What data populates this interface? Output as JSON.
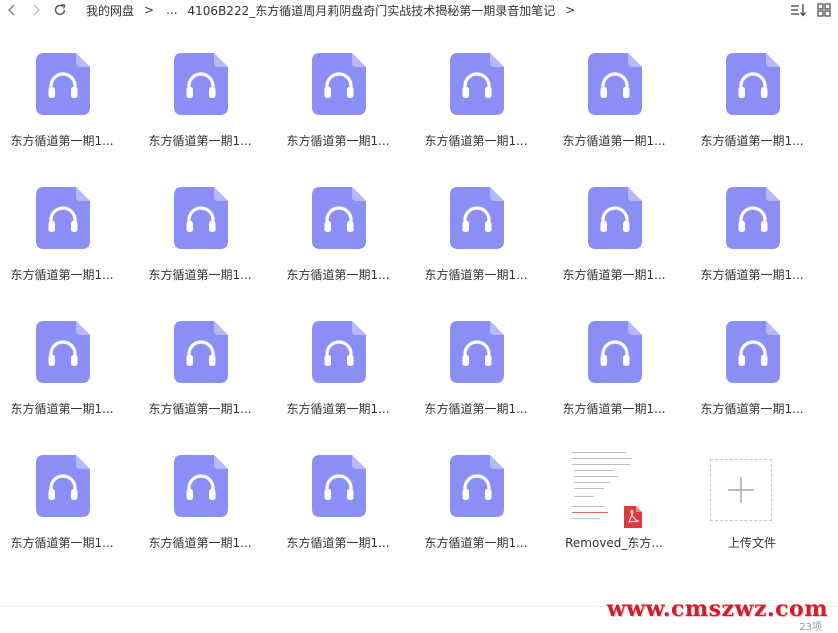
{
  "toolbar": {
    "back_icon": "chevron-left-icon",
    "forward_icon": "chevron-right-icon",
    "refresh_icon": "refresh-icon",
    "crumb_root": "我的网盘",
    "crumb_sep": ">",
    "crumb_ellipsis": "...",
    "crumb_current": "4106B222_东方循道周月莉阴盘奇门实战技术揭秘第一期录音加笔记",
    "crumb_trail_sep": ">",
    "sort_icon": "sort-icon",
    "view_icon": "view-toggle-icon"
  },
  "files": [
    {
      "name": "东方循道第一期1...",
      "type": "audio"
    },
    {
      "name": "东方循道第一期1...",
      "type": "audio"
    },
    {
      "name": "东方循道第一期1...",
      "type": "audio"
    },
    {
      "name": "东方循道第一期1...",
      "type": "audio"
    },
    {
      "name": "东方循道第一期1...",
      "type": "audio"
    },
    {
      "name": "东方循道第一期1...",
      "type": "audio"
    },
    {
      "name": "东方循道第一期1...",
      "type": "audio"
    },
    {
      "name": "东方循道第一期1...",
      "type": "audio"
    },
    {
      "name": "东方循道第一期1...",
      "type": "audio"
    },
    {
      "name": "东方循道第一期1...",
      "type": "audio"
    },
    {
      "name": "东方循道第一期1...",
      "type": "audio"
    },
    {
      "name": "东方循道第一期1...",
      "type": "audio"
    },
    {
      "name": "东方循道第一期1...",
      "type": "audio"
    },
    {
      "name": "东方循道第一期1...",
      "type": "audio"
    },
    {
      "name": "东方循道第一期1...",
      "type": "audio"
    },
    {
      "name": "东方循道第一期1...",
      "type": "audio"
    },
    {
      "name": "东方循道第一期1...",
      "type": "audio"
    },
    {
      "name": "东方循道第一期1...",
      "type": "audio"
    },
    {
      "name": "东方循道第一期1...",
      "type": "audio"
    },
    {
      "name": "东方循道第一期1...",
      "type": "audio"
    },
    {
      "name": "东方循道第一期1...",
      "type": "audio"
    },
    {
      "name": "东方循道第一期1...",
      "type": "audio"
    }
  ],
  "pdf_file": {
    "name": "Removed_东方...",
    "type": "pdf",
    "badge_icon": "pdf-icon"
  },
  "upload": {
    "label": "上传文件",
    "icon": "plus-icon"
  },
  "footer": {
    "watermark": "www.cmszwz.com",
    "count_text": "23项"
  },
  "colors": {
    "audio_icon": "#8b8ff5",
    "audio_icon_fold": "#b5b8fa",
    "pdf_red": "#e2383f",
    "watermark_red": "#d21c2a"
  }
}
